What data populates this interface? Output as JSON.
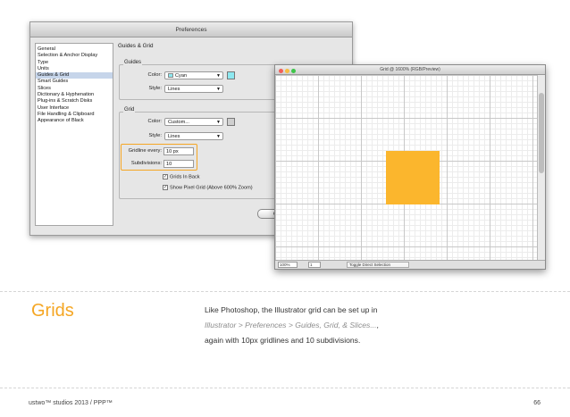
{
  "preferences": {
    "title": "Preferences",
    "categories": [
      "General",
      "Selection & Anchor Display",
      "Type",
      "Units",
      "Guides & Grid",
      "Smart Guides",
      "Slices",
      "Dictionary & Hyphenation",
      "Plug-ins & Scratch Disks",
      "User Interface",
      "File Handling & Clipboard",
      "Appearance of Black"
    ],
    "selected_category": "Guides & Grid",
    "section_title": "Guides & Grid",
    "guides": {
      "group_label": "Guides",
      "color_label": "Color:",
      "color_value": "Cyan",
      "color_hex": "#8de8f0",
      "style_label": "Style:",
      "style_value": "Lines"
    },
    "grid": {
      "group_label": "Grid",
      "color_label": "Color:",
      "color_value": "Custom...",
      "color_hex": "#cfcfcf",
      "style_label": "Style:",
      "style_value": "Lines",
      "gridline_label": "Gridline every:",
      "gridline_value": "10 px",
      "subdivisions_label": "Subdivisions:",
      "subdivisions_value": "10",
      "grids_in_back_label": "Grids In Back",
      "grids_in_back_checked": true,
      "pixel_grid_label": "Show Pixel Grid (Above 600% Zoom)",
      "pixel_grid_checked": true
    },
    "cancel_label": "C"
  },
  "document": {
    "title": "Grid @ 1600% (RGB/Preview)",
    "zoom": "100%",
    "page": "1",
    "status_info": "Toggle Direct Selection",
    "square_color": "#fbb62d"
  },
  "slide": {
    "heading": "Grids",
    "body_part1": "Like Photoshop, the Illustrator grid can be set up in ",
    "body_italic": "Illustrator > Preferences > Guides, Grid, & Slices...",
    "body_part2": ", again with 10px gridlines and 10 subdivisions.",
    "footer_left": "ustwo™ studios 2013  /  PPP™",
    "page_number": "66",
    "accent": "#f5a623"
  }
}
